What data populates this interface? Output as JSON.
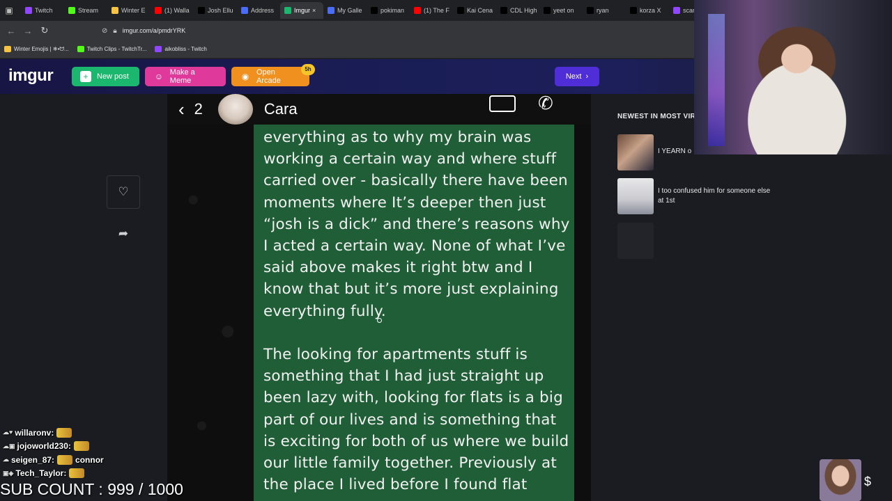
{
  "browser": {
    "tabs": [
      {
        "label": "Twitch",
        "color": "#9146ff",
        "active": false
      },
      {
        "label": "Stream",
        "color": "#53fc18",
        "active": false
      },
      {
        "label": "Winter E",
        "color": "#f6c343",
        "active": false
      },
      {
        "label": "(1) Walla",
        "color": "#ff0000",
        "active": false
      },
      {
        "label": "Josh Ellu",
        "color": "#000000",
        "active": false
      },
      {
        "label": "Address",
        "color": "#4a6cf7",
        "active": false
      },
      {
        "label": "Imgur",
        "color": "#1bb76e",
        "active": true
      },
      {
        "label": "My Galle",
        "color": "#4a6cf7",
        "active": false
      },
      {
        "label": "pokiman",
        "color": "#000000",
        "active": false
      },
      {
        "label": "(1) The F",
        "color": "#ff0000",
        "active": false
      },
      {
        "label": "Kai Cena",
        "color": "#000000",
        "active": false
      },
      {
        "label": "CDL High",
        "color": "#000000",
        "active": false
      },
      {
        "label": "yeet on",
        "color": "#000000",
        "active": false
      },
      {
        "label": "ryan",
        "color": "#000000",
        "active": false
      },
      {
        "label": "korza X",
        "color": "#000000",
        "active": false
      },
      {
        "label": "scaredy",
        "color": "#9146ff",
        "active": false
      }
    ],
    "url": "imgur.com/a/pmdrYRK",
    "bookmarks": [
      {
        "label": "Winter Emojis | ❄•ᗢ...",
        "color": "#f6c343"
      },
      {
        "label": "Twitch Clips - TwitchTr...",
        "color": "#53fc18"
      },
      {
        "label": "aikobliss - Twitch",
        "color": "#9146ff"
      }
    ]
  },
  "imgur": {
    "logo": "imgur",
    "new_post": "New post",
    "make_meme": "Make a Meme",
    "open_arcade": "Open Arcade",
    "arcade_badge": "5h",
    "next": "Next"
  },
  "chat_screenshot": {
    "count": "2",
    "contact_name": "Cara",
    "paragraph_1": "everything as to why my brain was working a certain way and where stuff carried over - basically there have been moments where It’s deeper then just “josh is a dick” and there’s reasons why I acted a certain way. None of what I’ve said above makes it right btw and I know that but it’s more just explaining everything fully.",
    "paragraph_2": "The looking for apartments stuff is something that I had just straight up been lazy with, looking for flats is a big part of our lives and is something that is exciting for both of us where we build our little family together. Previously at the place I lived before I found flat"
  },
  "sidebar": {
    "title": "NEWEST IN MOST VIRAL",
    "items": [
      {
        "caption": "I YEARN o"
      },
      {
        "caption": "I too confused him for someone else at 1st"
      },
      {
        "caption": ""
      }
    ]
  },
  "stream_overlay": {
    "chat": [
      {
        "badges": "☁♥",
        "user": "willaronv:",
        "message": ""
      },
      {
        "badges": "☁▣",
        "user": "jojoworld230:",
        "message": ""
      },
      {
        "badges": "☁",
        "user": "seigen_87:",
        "message": "connor"
      },
      {
        "badges": "▣◈",
        "user": "Tech_Taylor:",
        "message": ""
      }
    ],
    "sub_count": "SUB COUNT : 999 / 1000"
  }
}
